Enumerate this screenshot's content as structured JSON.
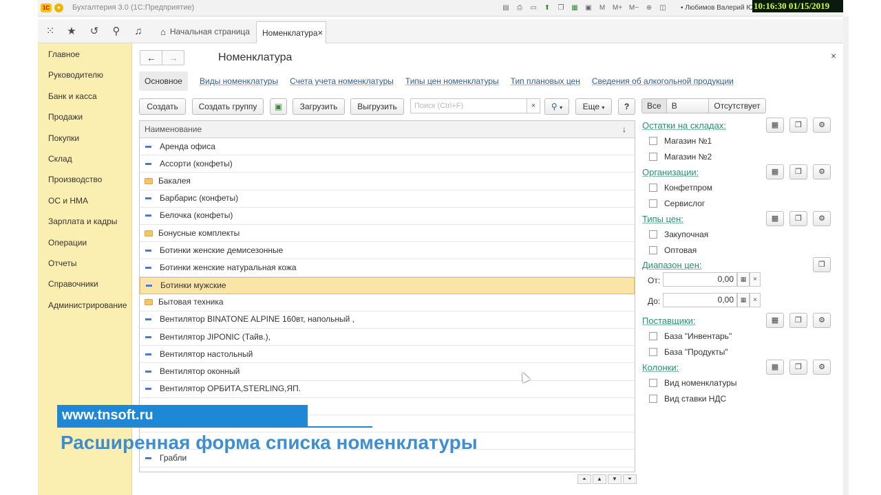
{
  "window": {
    "logo": "1С",
    "title": "Бухгалтерия 3.0  (1С:Предприятие)",
    "user": "Любимов Валерий Ю",
    "toolbar_icons": [
      "save-icon",
      "print-icon",
      "preview-icon",
      "upload-icon",
      "copy-icon",
      "calendar-icon",
      "calc-icon",
      "M",
      "M+",
      "M-",
      "zoom-icon",
      "layout-icon"
    ],
    "m_label": "M",
    "mplus_label": "M+",
    "mminus_label": "M−",
    "clock": "10:16:30  01/15/2019"
  },
  "tabs": {
    "home_label": "Начальная страница",
    "active_label": "Номенклатура"
  },
  "sidebar": {
    "items": [
      {
        "label": "Главное"
      },
      {
        "label": "Руководителю"
      },
      {
        "label": "Банк и касса"
      },
      {
        "label": "Продажи"
      },
      {
        "label": "Покупки"
      },
      {
        "label": "Склад"
      },
      {
        "label": "Производство"
      },
      {
        "label": "ОС и НМА"
      },
      {
        "label": "Зарплата и кадры"
      },
      {
        "label": "Операции"
      },
      {
        "label": "Отчеты"
      },
      {
        "label": "Справочники"
      },
      {
        "label": "Администрирование"
      }
    ]
  },
  "form": {
    "title": "Номенклатура",
    "links": {
      "main": "Основное",
      "kinds": "Виды номенклатуры",
      "accounts": "Счета учета номенклатуры",
      "price_types": "Типы цен номенклатуры",
      "plan_price_type": "Тип плановых цен",
      "alcohol": "Сведения об алкогольной продукции"
    },
    "toolbar": {
      "create": "Создать",
      "create_group": "Создать группу",
      "load": "Загрузить",
      "unload": "Выгрузить",
      "search_placeholder": "Поиск (Ctrl+F)",
      "more": "Еще",
      "help": "?",
      "filter_all": "Все",
      "filter_available": "В наличии",
      "filter_absent": "Отсутствует"
    },
    "list": {
      "column_header": "Наименование",
      "rows": [
        {
          "label": "Аренда офиса",
          "kind": "item"
        },
        {
          "label": "Ассорти (конфеты)",
          "kind": "item"
        },
        {
          "label": "Бакалея",
          "kind": "folder"
        },
        {
          "label": "Барбарис (конфеты)",
          "kind": "item"
        },
        {
          "label": "Белочка (конфеты)",
          "kind": "item"
        },
        {
          "label": "Бонусные комплекты",
          "kind": "folder"
        },
        {
          "label": "Ботинки женские демисезонные",
          "kind": "item"
        },
        {
          "label": "Ботинки женские натуральная кожа",
          "kind": "item"
        },
        {
          "label": "Ботинки мужские",
          "kind": "item",
          "selected": true
        },
        {
          "label": "Бытовая техника",
          "kind": "folder"
        },
        {
          "label": "Вентилятор BINATONE ALPINE 160вт, напольный ,",
          "kind": "item"
        },
        {
          "label": "Вентилятор JIPONIC (Тайв.),",
          "kind": "item"
        },
        {
          "label": "Вентилятор настольный",
          "kind": "item"
        },
        {
          "label": "Вентилятор оконный",
          "kind": "item"
        },
        {
          "label": "Вентилятор ОРБИТА,STERLING,ЯП.",
          "kind": "item"
        },
        {
          "label": "",
          "kind": "blank"
        },
        {
          "label": "",
          "kind": "blank"
        },
        {
          "label": "",
          "kind": "blank"
        },
        {
          "label": "Грабли",
          "kind": "item"
        }
      ]
    }
  },
  "panel": {
    "stock": {
      "title": "Остатки на складах:",
      "options": [
        "Магазин №1",
        "Магазин №2"
      ]
    },
    "orgs": {
      "title": "Организации:",
      "options": [
        "Конфетпром",
        "Сервислог"
      ]
    },
    "price_types": {
      "title": "Типы цен:",
      "options": [
        "Закупочная",
        "Оптовая"
      ]
    },
    "price_range": {
      "title": "Диапазон цен:",
      "from_label": "От:",
      "from_value": "0,00",
      "to_label": "До:",
      "to_value": "0,00"
    },
    "suppliers": {
      "title": "Поставщики:",
      "options": [
        "База \"Инвентарь\"",
        "База \"Продукты\""
      ]
    },
    "columns": {
      "title": "Колонки:",
      "options": [
        "Вид номенклатуры",
        "Вид ставки НДС"
      ]
    }
  },
  "overlay": {
    "url": "www.tnsoft.ru",
    "caption": "Расширенная форма списка номенклатуры"
  }
}
